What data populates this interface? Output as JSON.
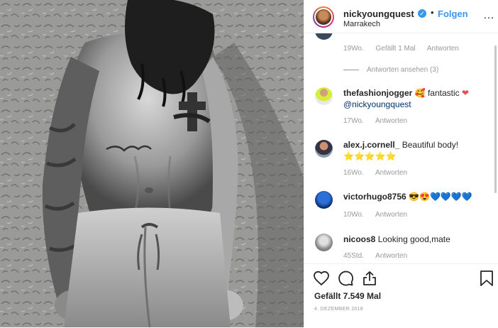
{
  "post": {
    "username": "nickyoungquest",
    "verified_mark": "✓",
    "separator": "•",
    "follow_label": "Folgen",
    "location": "Marrakech",
    "more_icon": "…"
  },
  "comments": [
    {
      "meta": {
        "time": "19Wo.",
        "likes": "Gefällt 1 Mal",
        "reply": "Antworten"
      },
      "view_replies": "Antworten ansehen (3)"
    },
    {
      "username": "thefashionjogger",
      "text": "🥰 fantastic",
      "heart": "❤",
      "mention": "@nickyoungquest",
      "meta": {
        "time": "17Wo.",
        "reply": "Antworten"
      }
    },
    {
      "username": "alex.j.cornell_",
      "text": "Beautiful body!",
      "stars": "⭐⭐⭐⭐⭐",
      "meta": {
        "time": "16Wo.",
        "reply": "Antworten"
      }
    },
    {
      "username": "victorhugo8756",
      "text": "😎😍",
      "hearts": "💙💙💙💙",
      "meta": {
        "time": "10Wo.",
        "reply": "Antworten"
      }
    },
    {
      "username": "nicoos8",
      "text": "Looking good,mate",
      "meta": {
        "time": "45Std.",
        "reply": "Antworten"
      }
    }
  ],
  "footer": {
    "likes": "Gefällt 7.549 Mal",
    "date": "4. DEZEMBER 2018"
  },
  "colors": {
    "accent": "#3897f0",
    "muted": "#999999",
    "text": "#262626",
    "red_heart": "#ed4956"
  },
  "icons": [
    "heart-icon",
    "comment-icon",
    "share-icon",
    "bookmark-icon",
    "more-icon",
    "verified-icon"
  ]
}
